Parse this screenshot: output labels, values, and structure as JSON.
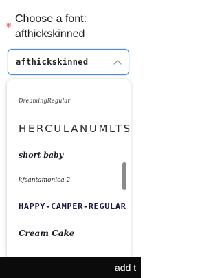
{
  "form": {
    "required_marker": "*",
    "prompt_label": "Choose a font: afthickskinned"
  },
  "select": {
    "value": "afthickskinned",
    "chevron_icon": "chevron-up-icon",
    "accent_color": "#4a8ad8"
  },
  "dropdown": {
    "options": [
      "DreamingRegular",
      "HERCULANUMLTSTD",
      "short baby",
      "kfsantamonica-2",
      "HAPPY-CAMPER-REGULAR",
      "Cream Cake"
    ]
  },
  "footer": {
    "text": "add t"
  }
}
